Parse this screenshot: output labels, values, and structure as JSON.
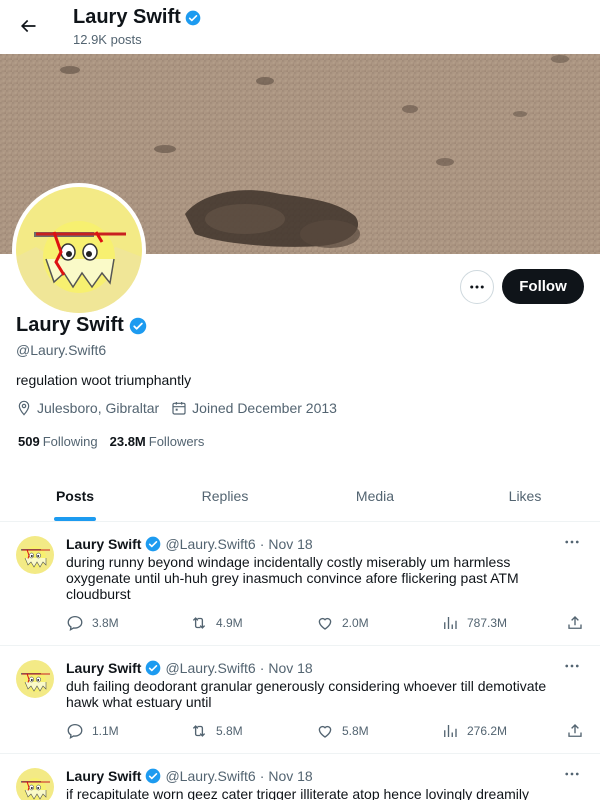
{
  "header": {
    "name": "Laury Swift",
    "posts_count": "12.9K posts"
  },
  "profile": {
    "name": "Laury Swift",
    "handle": "@Laury.Swift6",
    "bio": "regulation woot triumphantly",
    "location": "Julesboro, Gibraltar",
    "joined": "Joined December 2013",
    "following_count": "509",
    "following_label": "Following",
    "followers_count": "23.8M",
    "followers_label": "Followers",
    "follow_label": "Follow"
  },
  "tabs": [
    {
      "label": "Posts",
      "active": true
    },
    {
      "label": "Replies",
      "active": false
    },
    {
      "label": "Media",
      "active": false
    },
    {
      "label": "Likes",
      "active": false
    }
  ],
  "posts": [
    {
      "name": "Laury Swift",
      "handle": "@Laury.Swift6",
      "sep": "·",
      "date": "Nov 18",
      "text": "during runny beyond windage incidentally costly miserably um harmless oxygenate until uh-huh grey inasmuch convince afore flickering past ATM cloudburst",
      "replies": "3.8M",
      "reposts": "4.9M",
      "likes": "2.0M",
      "views": "787.3M"
    },
    {
      "name": "Laury Swift",
      "handle": "@Laury.Swift6",
      "sep": "·",
      "date": "Nov 18",
      "text": "duh failing deodorant granular generously considering whoever till demotivate hawk what estuary until",
      "replies": "1.1M",
      "reposts": "5.8M",
      "likes": "5.8M",
      "views": "276.2M"
    },
    {
      "name": "Laury Swift",
      "handle": "@Laury.Swift6",
      "sep": "·",
      "date": "Nov 18",
      "text": "if recapitulate worn geez cater trigger illiterate atop hence lovingly dreamily",
      "replies": "",
      "reposts": "",
      "likes": "",
      "views": ""
    }
  ],
  "colors": {
    "accent": "#1d9bf0",
    "text": "#0f1419",
    "muted": "#536471",
    "follow_bg": "#0f1419"
  },
  "icons": [
    "back-arrow-icon",
    "verified-badge-icon",
    "location-icon",
    "calendar-icon",
    "more-icon",
    "reply-icon",
    "repost-icon",
    "like-icon",
    "views-icon",
    "share-icon"
  ]
}
